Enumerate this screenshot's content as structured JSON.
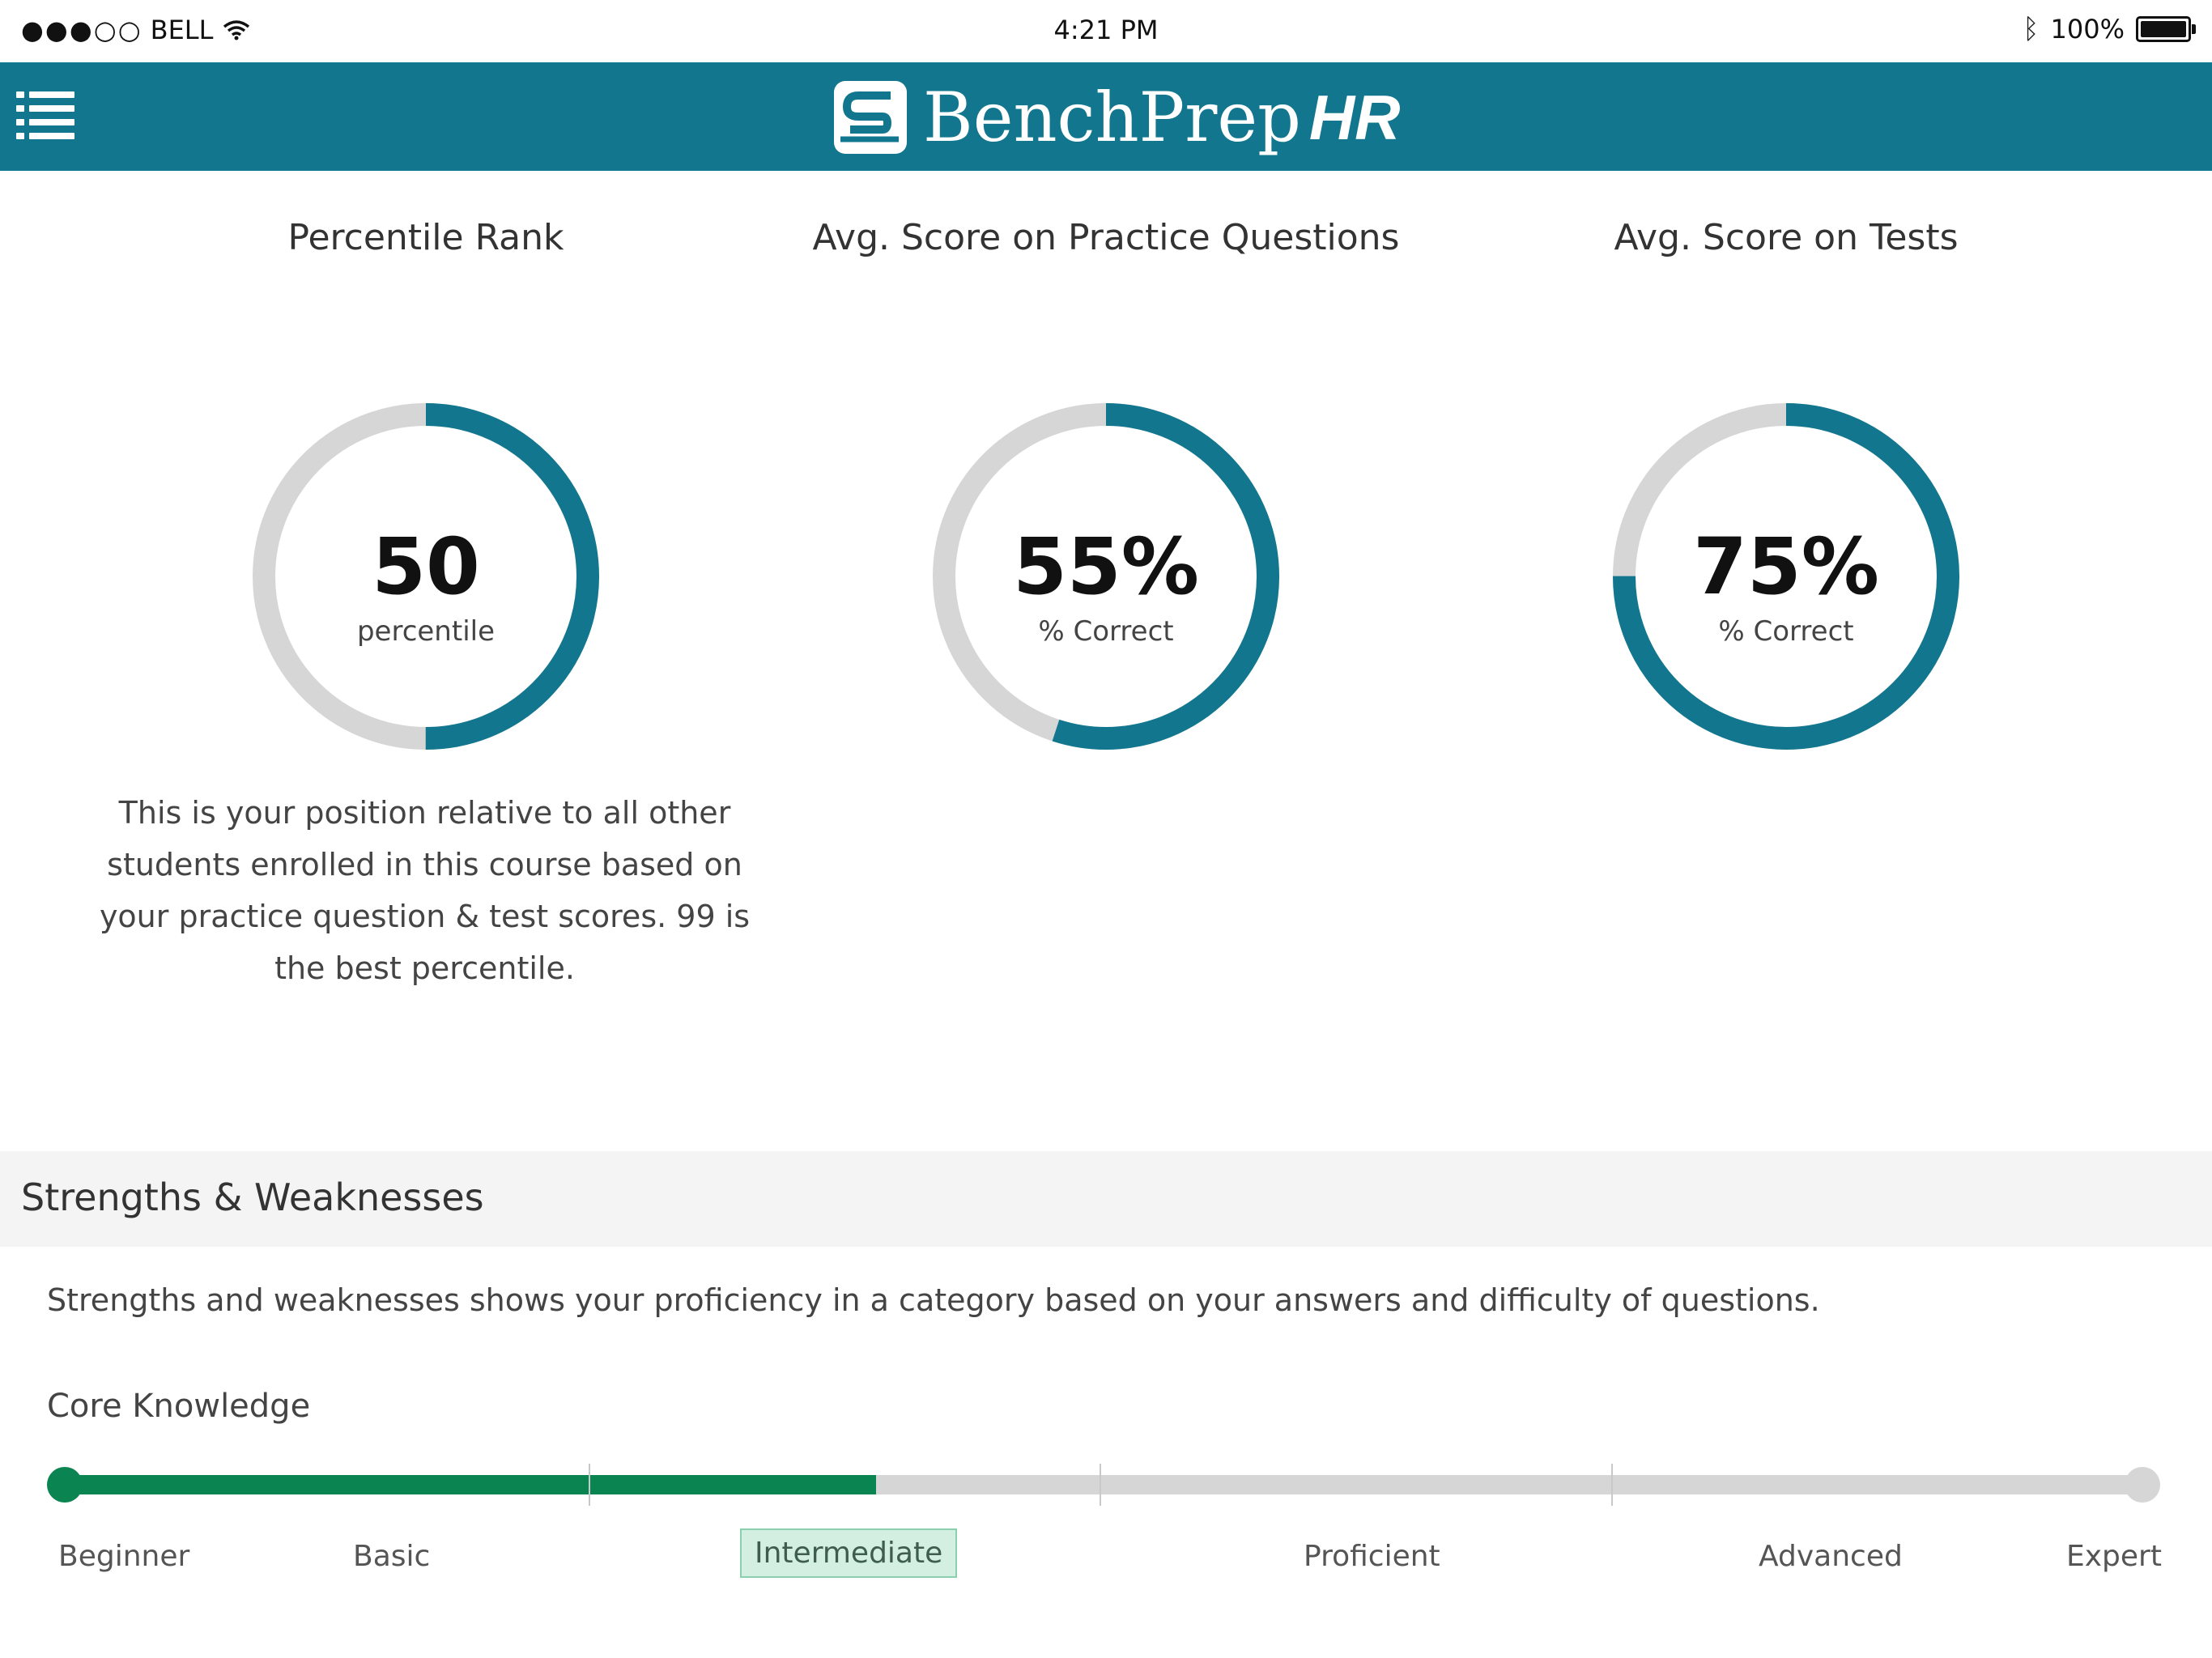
{
  "status_bar": {
    "signal": "●●●○○",
    "carrier": "BELL",
    "time": "4:21 PM",
    "battery": "100%",
    "icons": [
      "wifi-icon",
      "bluetooth-icon",
      "battery-icon"
    ]
  },
  "header": {
    "brand": "BenchPrep",
    "brand_suffix": "HR",
    "menu_icon": "list-menu-icon",
    "color": "#12778e"
  },
  "metrics": [
    {
      "title": "Percentile Rank",
      "value": "50",
      "caption": "percentile",
      "progress": 0.5
    },
    {
      "title": "Avg. Score on Practice Questions",
      "value": "55%",
      "caption": "% Correct",
      "progress": 0.55
    },
    {
      "title": "Avg. Score on Tests",
      "value": "75%",
      "caption": "% Correct",
      "progress": 0.75
    }
  ],
  "percentile_description": "This is your position relative to all other students enrolled in this course based on your practice question & test scores. 99 is the best percentile.",
  "strengths": {
    "title": "Strengths & Weaknesses",
    "description": "Strengths and weaknesses shows your proficiency in a category based on your answers and difficulty of questions.",
    "category": "Core Knowledge",
    "levels": [
      "Beginner",
      "Basic",
      "Intermediate",
      "Proficient",
      "Advanced",
      "Expert"
    ],
    "current_level": "Intermediate",
    "progress": 0.39,
    "colors": {
      "fill": "#0a8552",
      "track": "#d6d6d6"
    }
  },
  "colors": {
    "ring_fill": "#12778e",
    "ring_track": "#d6d6d6"
  }
}
